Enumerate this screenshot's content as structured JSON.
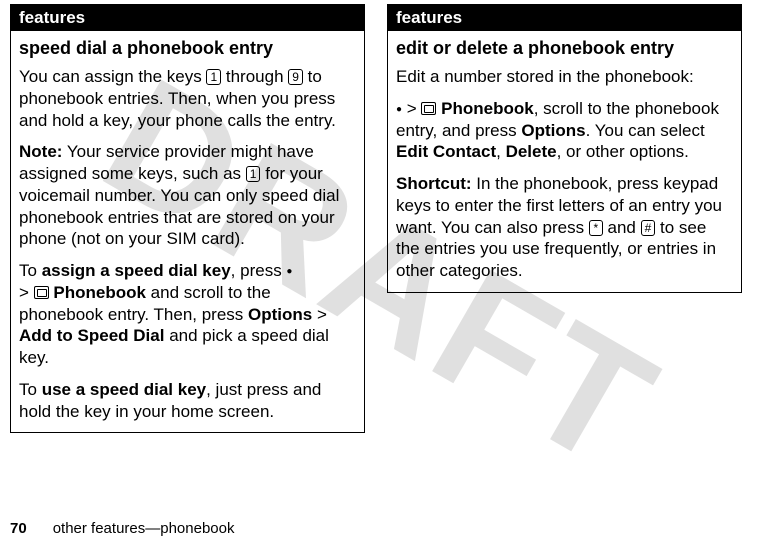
{
  "watermark": "DRAFT",
  "left": {
    "header": "features",
    "title": "speed dial a phonebook entry",
    "p1_a": "You can assign the keys ",
    "key1": "1",
    "p1_b": " through ",
    "key9": "9",
    "p1_c": " to phonebook entries. Then, when you press and hold a key, your phone calls the entry.",
    "note_label": "Note:",
    "note_a": " Your service provider might have assigned some keys, such as ",
    "note_key": "1",
    "note_b": " for your voicemail number. You can only speed dial phonebook entries that are stored on your phone (not on your SIM card).",
    "assign_a": "To ",
    "assign_bold": "assign a speed dial key",
    "assign_b": ", press ",
    "assign_c": "> ",
    "phonebook_label": "Phonebook",
    "assign_d": " and scroll to the phonebook entry. Then, press ",
    "options_label": "Options",
    "assign_e": " > ",
    "add_speed_label": "Add to Speed Dial",
    "assign_f": " and pick a speed dial key.",
    "use_a": "To ",
    "use_bold": "use a speed dial key",
    "use_b": ", just press and hold the key in your home screen."
  },
  "right": {
    "header": "features",
    "title": "edit or delete a phonebook entry",
    "p1": "Edit a number stored in the phonebook:",
    "p2_a": "> ",
    "phonebook_label": "Phonebook",
    "p2_b": ", scroll to the phonebook entry, and press ",
    "options_label": "Options",
    "p2_c": ". You can select ",
    "edit_label": "Edit Contact",
    "p2_d": ", ",
    "delete_label": "Delete",
    "p2_e": ", or other options.",
    "shortcut_label": "Shortcut:",
    "shortcut_a": " In the phonebook, press keypad keys to enter the first letters of an entry you want. You can also press ",
    "key_star": "*",
    "shortcut_b": " and ",
    "key_hash": "#",
    "shortcut_c": " to see the entries you use frequently, or entries in other categories."
  },
  "footer": {
    "page": "70",
    "section": "other features—phonebook"
  }
}
